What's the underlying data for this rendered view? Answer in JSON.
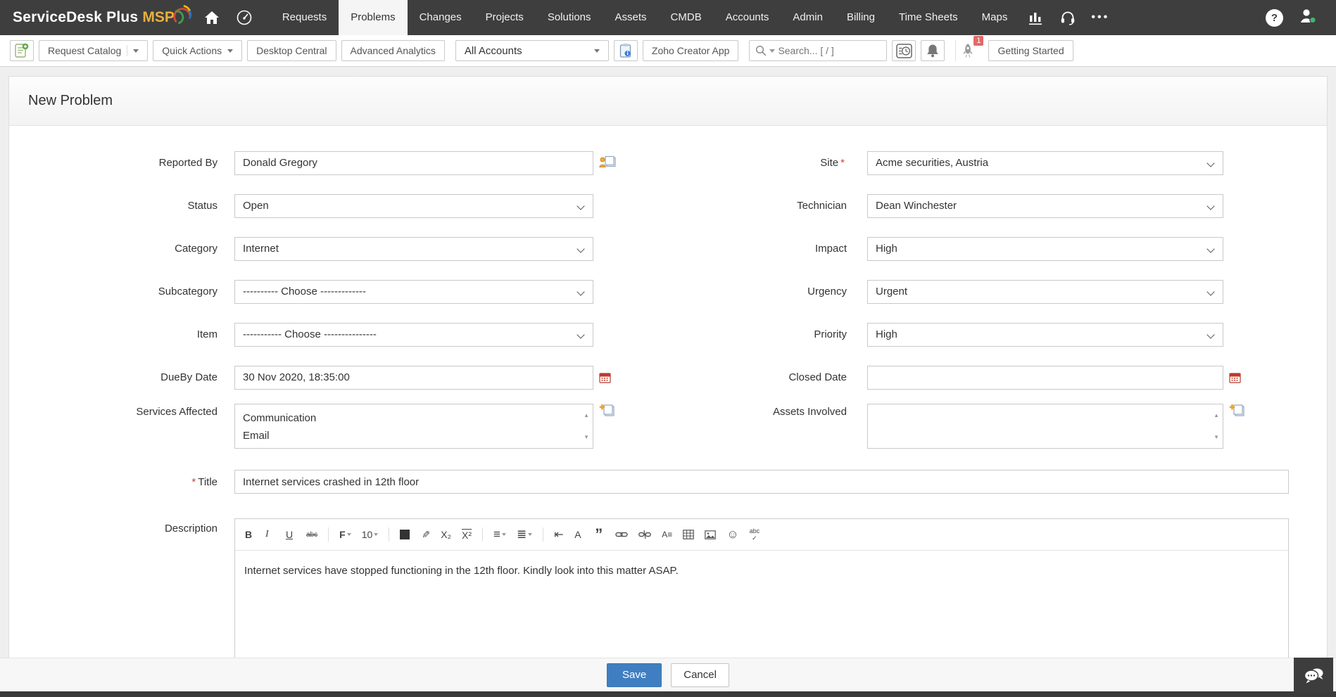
{
  "ui": {
    "required_marker": "*",
    "scroll_up": "▲",
    "scroll_down": "▼",
    "overflow_ellipsis": "•••"
  },
  "topnav": {
    "brand": {
      "name": "ServiceDesk Plus",
      "suffix": "MSP"
    },
    "tabs": [
      "Requests",
      "Problems",
      "Changes",
      "Projects",
      "Solutions",
      "Assets",
      "CMDB",
      "Accounts",
      "Admin",
      "Billing",
      "Time Sheets",
      "Maps"
    ],
    "active_tab": "Problems"
  },
  "toolbar": {
    "request_catalog": "Request Catalog",
    "quick_actions": "Quick Actions",
    "desktop_central": "Desktop Central",
    "advanced_analytics": "Advanced Analytics",
    "account_filter": "All Accounts",
    "zoho_creator_app": "Zoho Creator App",
    "search_placeholder": "Search... [ / ]",
    "rocket_badge": "1",
    "getting_started": "Getting Started"
  },
  "page": {
    "title": "New Problem"
  },
  "form": {
    "reported_by": {
      "label": "Reported By",
      "value": "Donald Gregory"
    },
    "status": {
      "label": "Status",
      "value": "Open"
    },
    "category": {
      "label": "Category",
      "value": "Internet"
    },
    "subcategory": {
      "label": "Subcategory",
      "value": "---------- Choose -------------"
    },
    "item": {
      "label": "Item",
      "value": "----------- Choose ---------------"
    },
    "dueby_date": {
      "label": "DueBy Date",
      "value": "30 Nov 2020, 18:35:00"
    },
    "services_affected": {
      "label": "Services Affected",
      "values": [
        "Communication",
        "Email"
      ]
    },
    "site": {
      "label": "Site",
      "value": "Acme securities, Austria"
    },
    "technician": {
      "label": "Technician",
      "value": "Dean Winchester"
    },
    "impact": {
      "label": "Impact",
      "value": "High"
    },
    "urgency": {
      "label": "Urgency",
      "value": "Urgent"
    },
    "priority": {
      "label": "Priority",
      "value": "High"
    },
    "closed_date": {
      "label": "Closed Date",
      "value": ""
    },
    "assets_involved": {
      "label": "Assets Involved",
      "values": []
    },
    "title": {
      "label": "Title",
      "value": "Internet services crashed in 12th floor"
    },
    "description": {
      "label": "Description",
      "value": "Internet services have stopped functioning in the 12th floor. Kindly look into this matter ASAP."
    }
  },
  "editor": {
    "icons": {
      "bold": "B",
      "italic": "I",
      "underline": "U",
      "strikethrough": "abc",
      "font_name": "F",
      "font_size": "10",
      "highlight": "✎",
      "subscript": "X₂",
      "superscript": "X²",
      "align": "≡",
      "list": "≣",
      "indent": "⇤",
      "remove_format": "A",
      "blockquote": "”",
      "line_spacing": "A≡",
      "emoji": "☺",
      "spellcheck_text": "abc",
      "spellcheck_mark": "✓"
    }
  },
  "footer": {
    "save": "Save",
    "cancel": "Cancel"
  },
  "colors": {
    "accent_blue": "#3f7fc1",
    "nav_bg": "#3e3e3e",
    "badge_red": "#e16a6a",
    "required_red": "#d43f3f",
    "msp_gold": "#e8b13c"
  }
}
